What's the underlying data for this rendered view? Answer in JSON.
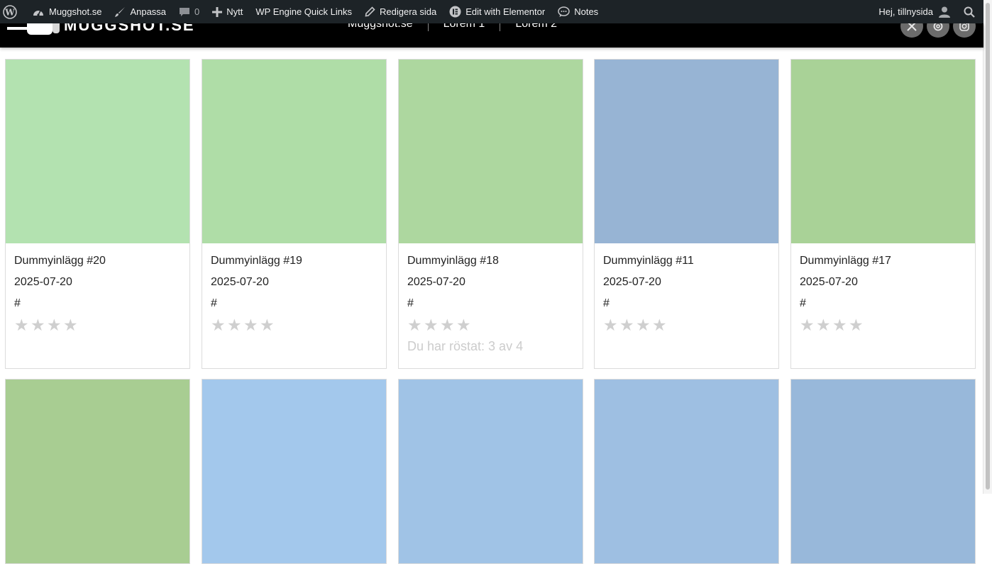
{
  "adminbar": {
    "site_name": "Muggshot.se",
    "customize": "Anpassa",
    "comments_count": "0",
    "new": "Nytt",
    "wp_engine": "WP Engine Quick Links",
    "edit_page": "Redigera sida",
    "edit_elementor": "Edit with Elementor",
    "notes": "Notes",
    "greeting": "Hej, tillnysida"
  },
  "header": {
    "nav": [
      "Muggshot.se",
      "Lorem 1",
      "Lorem 2"
    ],
    "social_icons": [
      "x-icon",
      "threads-icon",
      "instagram-icon"
    ]
  },
  "posts": [
    {
      "title": "Dummyinlägg #20",
      "date": "2025-07-20",
      "link": "#",
      "color": "#b3e2b0",
      "stars_total": 4,
      "voted": ""
    },
    {
      "title": "Dummyinlägg #19",
      "date": "2025-07-20",
      "link": "#",
      "color": "#afdda7",
      "stars_total": 4,
      "voted": ""
    },
    {
      "title": "Dummyinlägg #18",
      "date": "2025-07-20",
      "link": "#",
      "color": "#add79f",
      "stars_total": 4,
      "voted": "Du har röstat: 3 av 4"
    },
    {
      "title": "Dummyinlägg #11",
      "date": "2025-07-20",
      "link": "#",
      "color": "#97b4d4",
      "stars_total": 4,
      "voted": ""
    },
    {
      "title": "Dummyinlägg #17",
      "date": "2025-07-20",
      "link": "#",
      "color": "#a9d297",
      "stars_total": 4,
      "voted": ""
    },
    {
      "color": "#a8cd92"
    },
    {
      "color": "#a3c8ec"
    },
    {
      "color": "#a0c3e6"
    },
    {
      "color": "#9ebfe2"
    },
    {
      "color": "#98b8da"
    }
  ]
}
